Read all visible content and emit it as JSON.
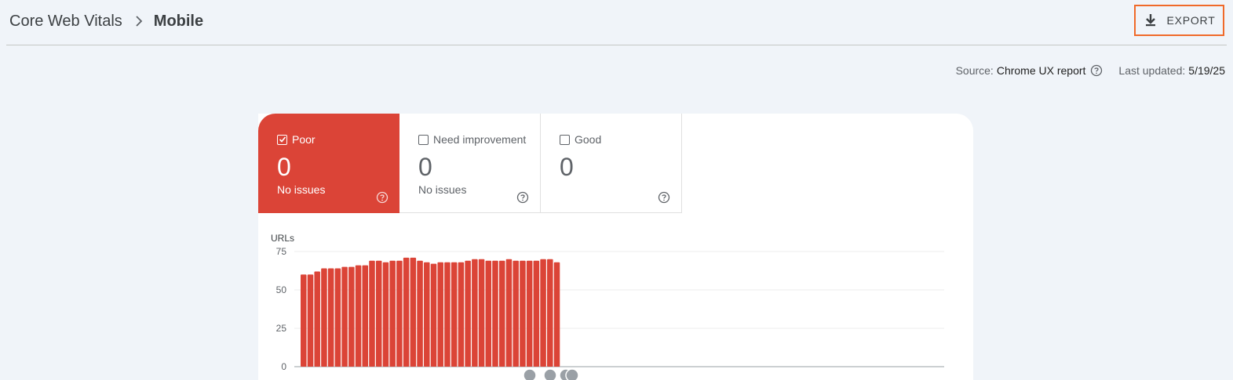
{
  "header": {
    "breadcrumb_parent": "Core Web Vitals",
    "breadcrumb_current": "Mobile",
    "export_label": "EXPORT"
  },
  "meta": {
    "source_label": "Source:",
    "source_value": "Chrome UX report",
    "updated_label": "Last updated:",
    "updated_value": "5/19/25"
  },
  "tiles": [
    {
      "label": "Poor",
      "count": "0",
      "sub": "No issues",
      "checked": true
    },
    {
      "label": "Need improvement",
      "count": "0",
      "sub": "No issues",
      "checked": false
    },
    {
      "label": "Good",
      "count": "0",
      "sub": "",
      "checked": false
    }
  ],
  "colors": {
    "poor": "#db4437",
    "accent_border": "#f06a2a",
    "background": "#f0f4f9"
  },
  "chart_data": {
    "type": "bar",
    "ylabel": "URLs",
    "ylim": [
      0,
      75
    ],
    "yticks": [
      "75",
      "50",
      "25",
      "0"
    ],
    "series": [
      {
        "values": [
          60,
          60,
          62,
          64,
          64,
          64,
          65,
          65,
          66,
          66,
          69,
          69,
          68,
          69,
          69,
          71,
          71,
          69,
          68,
          67,
          68,
          68,
          68,
          68,
          69,
          70,
          70,
          69,
          69,
          69,
          70,
          69,
          69,
          69,
          69,
          70,
          70,
          68
        ]
      }
    ],
    "total_slots": 94
  }
}
